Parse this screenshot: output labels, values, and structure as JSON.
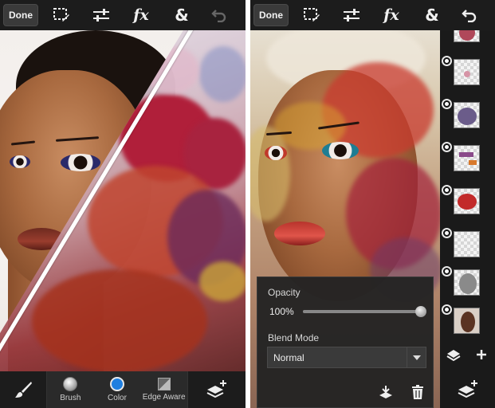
{
  "left_screen": {
    "toolbar": {
      "done_label": "Done",
      "tools": [
        {
          "name": "selection-tool",
          "icon": "marquee-pencil-icon"
        },
        {
          "name": "adjustments-tool",
          "icon": "sliders-icon"
        },
        {
          "name": "effects-tool",
          "icon": "fx-icon",
          "label": "fx"
        },
        {
          "name": "combine-tool",
          "icon": "ampersand-icon",
          "label": "&"
        },
        {
          "name": "undo-tool",
          "icon": "undo-icon",
          "enabled": false
        }
      ]
    },
    "bottom_bar": {
      "brush_icon": "brush-icon",
      "items": [
        {
          "label": "Brush",
          "icon": "brush-size-icon"
        },
        {
          "label": "Color",
          "icon": "color-swatch-icon",
          "color": "#1f7fe0"
        },
        {
          "label": "Edge Aware",
          "icon": "edge-aware-icon"
        }
      ],
      "layers_icon": "add-layer-icon"
    }
  },
  "right_screen": {
    "toolbar": {
      "done_label": "Done",
      "tools": [
        {
          "name": "selection-tool",
          "icon": "marquee-pencil-icon"
        },
        {
          "name": "adjustments-tool",
          "icon": "sliders-icon"
        },
        {
          "name": "effects-tool",
          "icon": "fx-icon",
          "label": "fx"
        },
        {
          "name": "combine-tool",
          "icon": "ampersand-icon",
          "label": "&"
        },
        {
          "name": "undo-tool",
          "icon": "undo-icon",
          "enabled": true
        }
      ]
    },
    "layer_properties": {
      "opacity_label": "Opacity",
      "opacity_value": "100%",
      "opacity_fraction": 1.0,
      "blend_mode_label": "Blend Mode",
      "blend_mode_value": "Normal"
    },
    "layers": {
      "count_visible": 8,
      "items": [
        {
          "thumb": "face-splash",
          "visible": true
        },
        {
          "thumb": "pink-splash",
          "visible": true
        },
        {
          "thumb": "purple-splash",
          "visible": true
        },
        {
          "thumb": "purple-orange-strokes",
          "visible": true
        },
        {
          "thumb": "red-splash",
          "visible": true
        },
        {
          "thumb": "transparent",
          "visible": true
        },
        {
          "thumb": "gray-face",
          "visible": true
        },
        {
          "thumb": "portrait-photo",
          "visible": true
        }
      ]
    }
  }
}
